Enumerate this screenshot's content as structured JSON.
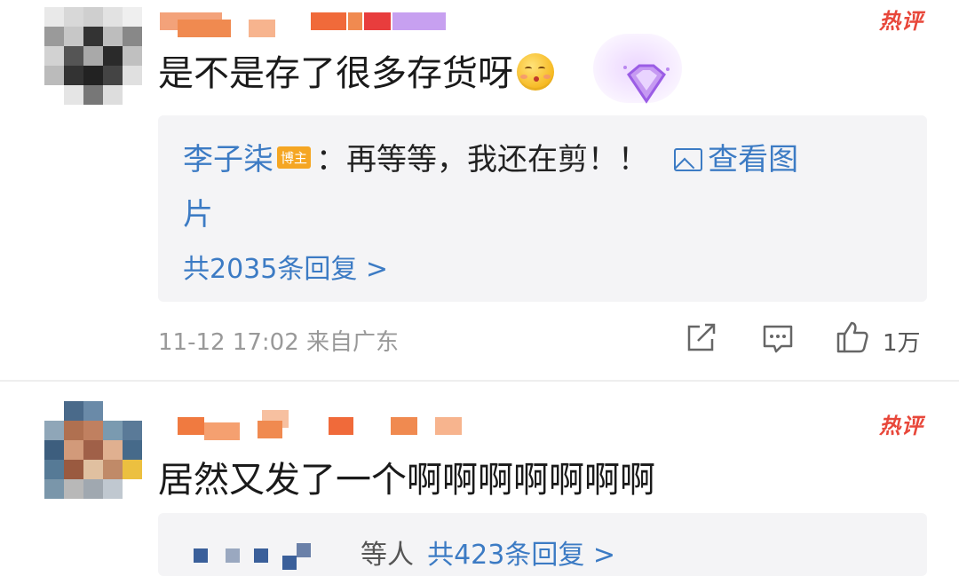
{
  "comments": [
    {
      "hot_label": "热评",
      "text": "是不是存了很多存货呀",
      "emoji": "kissing-face-emoji",
      "reply": {
        "author": "李子柒",
        "author_tag": "博主",
        "text": "：再等等，我还在剪！！",
        "view_image_line1": "查看图",
        "view_image_line2": "片",
        "reply_count_label": "共2035条回复 >"
      },
      "meta": "11-12 17:02 来自广东",
      "likes": "1万"
    },
    {
      "hot_label": "热评",
      "text": "居然又发了一个啊啊啊啊啊啊啊",
      "reply": {
        "people_label": "等人",
        "reply_count_label": "共423条回复 >"
      }
    }
  ],
  "colors": {
    "link": "#3c7bc4",
    "hot": "#e8473a",
    "tag": "#f5a623",
    "reply_bg": "#f4f4f6",
    "meta": "#999999"
  }
}
